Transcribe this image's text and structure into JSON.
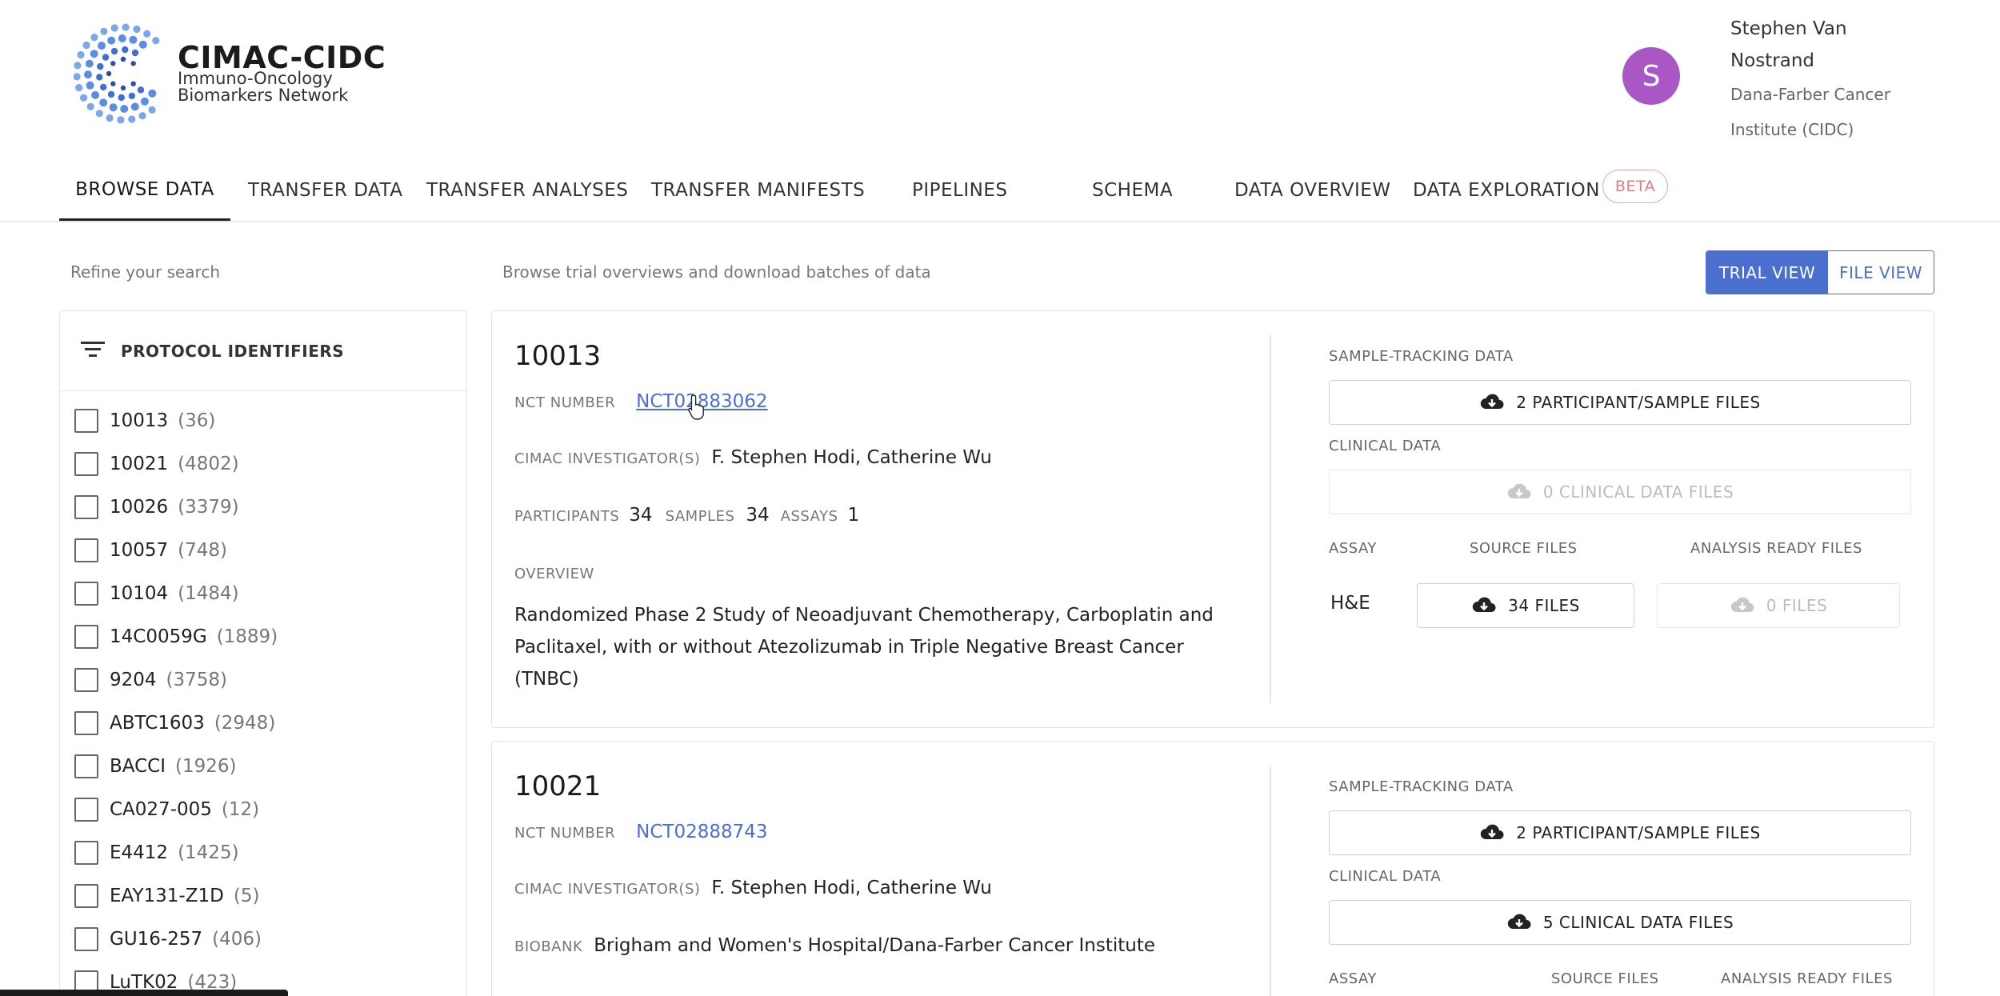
{
  "brand": {
    "title": "CIMAC-CIDC",
    "subtitle_line1": "Immuno-Oncology",
    "subtitle_line2": "Biomarkers Network"
  },
  "user": {
    "initial": "S",
    "name": "Stephen Van Nostrand",
    "org": "Dana-Farber Cancer Institute (CIDC)",
    "avatar_color": "#a957c4"
  },
  "nav": {
    "items": [
      "BROWSE DATA",
      "TRANSFER DATA",
      "TRANSFER ANALYSES",
      "TRANSFER MANIFESTS",
      "PIPELINES",
      "SCHEMA",
      "DATA OVERVIEW",
      "DATA EXPLORATION"
    ],
    "active": "BROWSE DATA",
    "beta_badge": "BETA"
  },
  "hints": {
    "refine": "Refine your search",
    "browse": "Browse trial overviews and download batches of data"
  },
  "view_toggle": {
    "trial_view": "TRIAL VIEW",
    "file_view": "FILE VIEW",
    "selected": "TRIAL VIEW",
    "accent": "#4b6fcf"
  },
  "filters": {
    "title": "PROTOCOL IDENTIFIERS",
    "items": [
      {
        "label": "10013",
        "count": "(36)"
      },
      {
        "label": "10021",
        "count": "(4802)"
      },
      {
        "label": "10026",
        "count": "(3379)"
      },
      {
        "label": "10057",
        "count": "(748)"
      },
      {
        "label": "10104",
        "count": "(1484)"
      },
      {
        "label": "14C0059G",
        "count": "(1889)"
      },
      {
        "label": "9204",
        "count": "(3758)"
      },
      {
        "label": "ABTC1603",
        "count": "(2948)"
      },
      {
        "label": "BACCI",
        "count": "(1926)"
      },
      {
        "label": "CA027-005",
        "count": "(12)"
      },
      {
        "label": "E4412",
        "count": "(1425)"
      },
      {
        "label": "EAY131-Z1D",
        "count": "(5)"
      },
      {
        "label": "GU16-257",
        "count": "(406)"
      },
      {
        "label": "LuTK02",
        "count": "(423)"
      }
    ]
  },
  "trials": [
    {
      "id": "10013",
      "nct_label": "NCT NUMBER",
      "nct": "NCT02883062",
      "investigators_label": "CIMAC INVESTIGATOR(S)",
      "investigators": "F. Stephen Hodi, Catherine Wu",
      "participants_label": "PARTICIPANTS",
      "participants": "34",
      "samples_label": "SAMPLES",
      "samples": "34",
      "assays_label": "ASSAYS",
      "assays": "1",
      "overview_label": "OVERVIEW",
      "overview": "Randomized Phase 2 Study of Neoadjuvant Chemotherapy, Carboplatin and Paclitaxel, with or without Atezolizumab in Triple Negative Breast Cancer (TNBC)",
      "sample_tracking_label": "SAMPLE-TRACKING DATA",
      "sample_tracking_btn": "2 PARTICIPANT/SAMPLE FILES",
      "clinical_label": "CLINICAL DATA",
      "clinical_btn": "0 CLINICAL DATA FILES",
      "assay_header": "ASSAY",
      "source_header": "SOURCE FILES",
      "analysis_header": "ANALYSIS READY FILES",
      "assay_name": "H&E",
      "source_btn": "34 FILES",
      "analysis_btn": "0 FILES"
    },
    {
      "id": "10021",
      "nct_label": "NCT NUMBER",
      "nct": "NCT02888743",
      "investigators_label": "CIMAC INVESTIGATOR(S)",
      "investigators": "F. Stephen Hodi, Catherine Wu",
      "biobank_label": "BIOBANK",
      "biobank": "Brigham and Women's Hospital/Dana-Farber Cancer Institute",
      "sample_tracking_label": "SAMPLE-TRACKING DATA",
      "sample_tracking_btn": "2 PARTICIPANT/SAMPLE FILES",
      "clinical_label": "CLINICAL DATA",
      "clinical_btn": "5 CLINICAL DATA FILES",
      "assay_header": "ASSAY",
      "source_header": "SOURCE FILES",
      "analysis_header": "ANALYSIS READY FILES"
    }
  ]
}
